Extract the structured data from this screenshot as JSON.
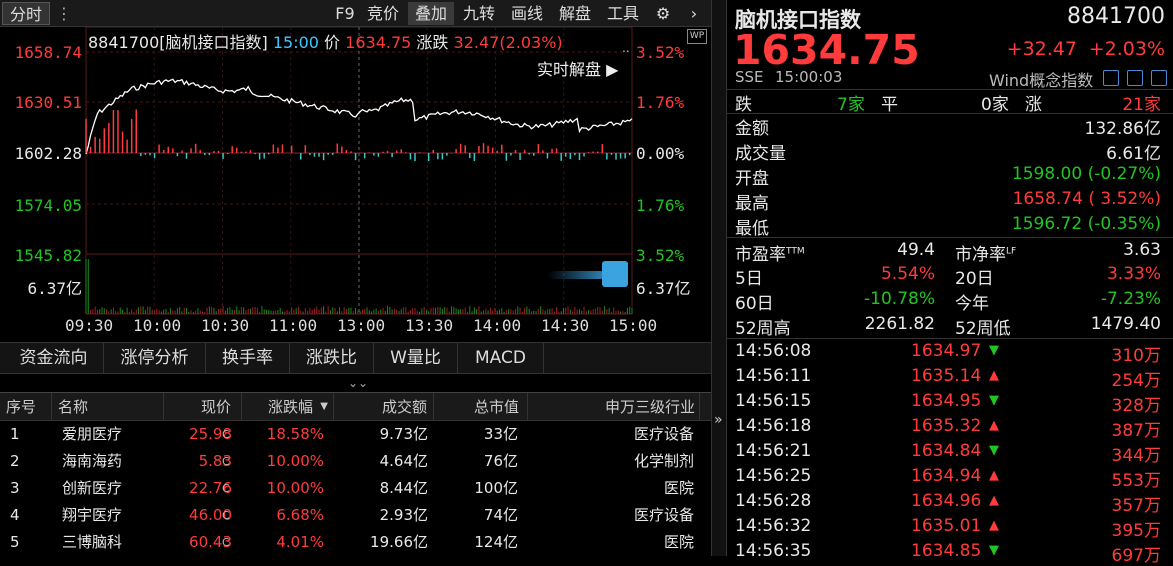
{
  "toolbar": {
    "fenshi": "分时",
    "menu_items": [
      "F9",
      "竞价",
      "叠加",
      "九转",
      "画线",
      "解盘",
      "工具"
    ]
  },
  "chart": {
    "info": {
      "code_name": "8841700[脑机接口指数]",
      "time": "15:00",
      "price_label": "价",
      "price": "1634.75",
      "change_label": "涨跌",
      "change": "32.47(2.03%)"
    },
    "jiepan": "实时解盘 ▶",
    "price_axis": [
      "1658.74",
      "1630.51",
      "1602.28",
      "1574.05",
      "1545.82"
    ],
    "pct_axis": [
      "3.52%",
      "1.76%",
      "0.00%",
      "1.76%",
      "3.52%"
    ],
    "volume_label": "6.37亿",
    "time_axis": [
      "09:30",
      "10:00",
      "10:30",
      "11:00",
      "13:00",
      "13:30",
      "14:00",
      "14:30",
      "15:00"
    ],
    "colors": {
      "up": "#ff3b3b",
      "down": "#21c521",
      "line": "#ffffff",
      "neg_bar": "#39c7c7"
    }
  },
  "indicator_tabs": [
    "资金流向",
    "涨停分析",
    "换手率",
    "涨跌比",
    "W量比",
    "MACD"
  ],
  "table": {
    "headers": [
      "序号",
      "名称",
      "现价",
      "涨跌幅",
      "成交额",
      "总市值",
      "申万三级行业"
    ],
    "rows": [
      {
        "no": "1",
        "name": "爱朋医疗",
        "price": "25.98",
        "pct": "18.58%",
        "amount": "9.73亿",
        "cap": "33亿",
        "industry": "医疗设备"
      },
      {
        "no": "2",
        "name": "海南海药",
        "price": "5.83",
        "pct": "10.00%",
        "amount": "4.64亿",
        "cap": "76亿",
        "industry": "化学制剂"
      },
      {
        "no": "3",
        "name": "创新医疗",
        "price": "22.76",
        "pct": "10.00%",
        "amount": "8.44亿",
        "cap": "100亿",
        "industry": "医院"
      },
      {
        "no": "4",
        "name": "翔宇医疗",
        "price": "46.00",
        "pct": "6.68%",
        "amount": "2.93亿",
        "cap": "74亿",
        "industry": "医疗设备"
      },
      {
        "no": "5",
        "name": "三博脑科",
        "price": "60.43",
        "pct": "4.01%",
        "amount": "19.66亿",
        "cap": "124亿",
        "industry": "医院"
      }
    ],
    "c_mark": "C"
  },
  "quote": {
    "name": "脑机接口指数",
    "code": "8841700",
    "price": "1634.75",
    "change": "+32.47",
    "change_pct": "+2.03%",
    "exchange": "SSE",
    "time": "15:00:03",
    "wind_label": "Wind概念指数",
    "fall_label": "跌",
    "fall_count": "7家",
    "flat_label": "平",
    "flat_count": "0家",
    "rise_label": "涨",
    "rise_count": "21家",
    "stats": [
      {
        "label": "金额",
        "value": "132.86亿",
        "color": "white"
      },
      {
        "label": "成交量",
        "value": "6.61亿",
        "color": "white"
      },
      {
        "label": "开盘",
        "value": "1598.00 (-0.27%)",
        "color": "green"
      },
      {
        "label": "最高",
        "value": "1658.74 ( 3.52%)",
        "color": "red"
      },
      {
        "label": "最低",
        "value": "1596.72 (-0.35%)",
        "color": "green"
      }
    ],
    "pe_label": "市盈率",
    "pe_sup": "TTM",
    "pe_value": "49.4",
    "pb_label": "市净率",
    "pb_sup": "LF",
    "pb_value": "3.63",
    "periods": [
      {
        "l1": "5日",
        "v1": "5.54%",
        "c1": "red",
        "l2": "20日",
        "v2": "3.33%",
        "c2": "red"
      },
      {
        "l1": "60日",
        "v1": "-10.78%",
        "c1": "green",
        "l2": "今年",
        "v2": "-7.23%",
        "c2": "green"
      },
      {
        "l1": "52周高",
        "v1": "2261.82",
        "c1": "white",
        "l2": "52周低",
        "v2": "1479.40",
        "c2": "white"
      }
    ],
    "ticks": [
      {
        "time": "14:56:08",
        "price": "1634.97",
        "dir": "down",
        "vol": "310万"
      },
      {
        "time": "14:56:11",
        "price": "1635.14",
        "dir": "up",
        "vol": "254万"
      },
      {
        "time": "14:56:15",
        "price": "1634.95",
        "dir": "down",
        "vol": "328万"
      },
      {
        "time": "14:56:18",
        "price": "1635.32",
        "dir": "up",
        "vol": "387万"
      },
      {
        "time": "14:56:21",
        "price": "1634.84",
        "dir": "down",
        "vol": "344万"
      },
      {
        "time": "14:56:25",
        "price": "1634.94",
        "dir": "up",
        "vol": "553万"
      },
      {
        "time": "14:56:28",
        "price": "1634.96",
        "dir": "up",
        "vol": "357万"
      },
      {
        "time": "14:56:32",
        "price": "1635.01",
        "dir": "up",
        "vol": "395万"
      },
      {
        "time": "14:56:35",
        "price": "1634.85",
        "dir": "down",
        "vol": "697万"
      }
    ]
  }
}
